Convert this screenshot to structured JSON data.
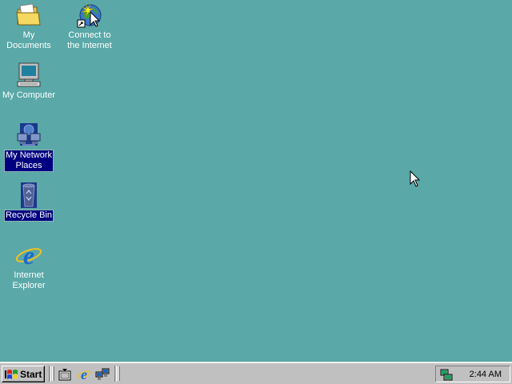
{
  "desktop": {
    "background_color": "#5aa8a8",
    "icons": [
      {
        "label": "My Documents",
        "icon": "folder-documents-icon",
        "selected": false
      },
      {
        "label": "Connect to\nthe Internet",
        "icon": "connect-internet-icon",
        "selected": false
      },
      {
        "label": "My Computer",
        "icon": "computer-icon",
        "selected": false
      },
      {
        "label": "My Network\nPlaces",
        "icon": "network-places-icon",
        "selected": true
      },
      {
        "label": "Recycle Bin",
        "icon": "recycle-bin-icon",
        "selected": true
      },
      {
        "label": "Internet\nExplorer",
        "icon": "internet-explorer-icon",
        "selected": false
      }
    ]
  },
  "taskbar": {
    "start_label": "Start",
    "quick_launch": [
      {
        "icon": "show-desktop-icon"
      },
      {
        "icon": "internet-explorer-icon"
      },
      {
        "icon": "network-connections-icon"
      }
    ],
    "tray": {
      "icon": "network-tray-icon",
      "clock": "2:44 AM"
    }
  }
}
